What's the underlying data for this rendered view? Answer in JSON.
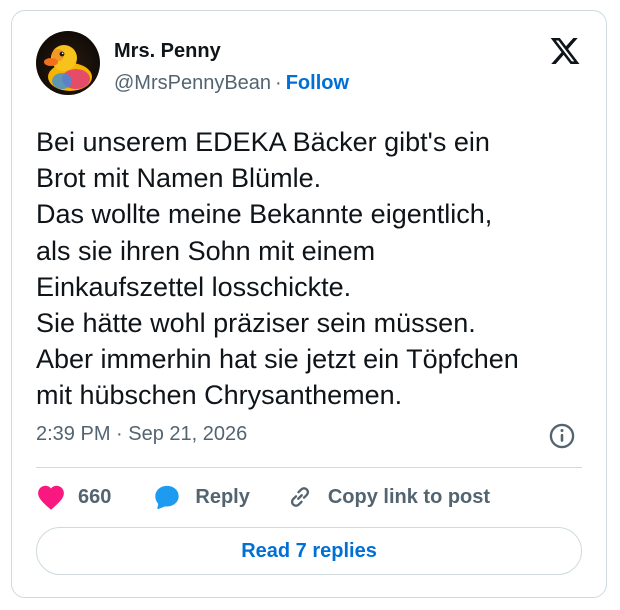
{
  "author": {
    "name": "Mrs. Penny",
    "handle": "@MrsPennyBean",
    "separator": "·",
    "follow_label": "Follow"
  },
  "icons": {
    "avatar": "rubber-duck-avatar",
    "logo": "x-logo-icon",
    "info": "info-icon",
    "like": "heart-icon",
    "reply": "speech-bubble-icon",
    "copy": "link-icon"
  },
  "tweet": {
    "text": "Bei unserem EDEKA Bäcker gibt's ein\nBrot mit Namen Blümle.\nDas wollte meine Bekannte eigentlich,\nals sie ihren Sohn mit einem\nEinkaufszettel losschickte.\nSie hätte wohl präziser sein müssen.\nAber immerhin hat sie jetzt ein Töpfchen\nmit hübschen Chrysanthemen.",
    "timestamp": "2:39 PM · Sep 21, 2026"
  },
  "actions": {
    "like_count": "660",
    "reply_label": "Reply",
    "copy_label": "Copy link to post"
  },
  "read_replies_label": "Read 7 replies",
  "colors": {
    "accent": "#006fd6",
    "like": "#f91880",
    "reply": "#1d9bf0",
    "text": "#0f1419",
    "muted": "#536471",
    "border": "#cfd9de"
  }
}
